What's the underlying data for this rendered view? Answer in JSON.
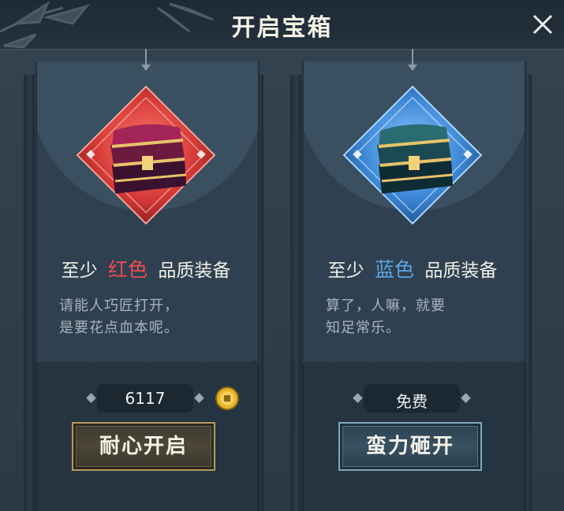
{
  "window": {
    "title": "开启宝箱",
    "close_icon": "close-icon"
  },
  "colors": {
    "red": "#ec4d4d",
    "blue": "#5aa6e6",
    "gold_border": "#b89a5d",
    "blue_border": "#7fa9bd"
  },
  "cards": [
    {
      "quality_prefix": "至少",
      "quality_color": "红色",
      "quality_suffix": "品质装备",
      "flavor_line1": "请能人巧匠打开，",
      "flavor_line2": "是要花点血本呢。",
      "price": "6117",
      "currency_icon": "gold-coin-icon",
      "button_label": "耐心开启",
      "chest_icon": "red-treasure-chest-icon"
    },
    {
      "quality_prefix": "至少",
      "quality_color": "蓝色",
      "quality_suffix": "品质装备",
      "flavor_line1": "算了，人嘛，就要",
      "flavor_line2": "知足常乐。",
      "price": "免费",
      "button_label": "蛮力砸开",
      "chest_icon": "blue-treasure-chest-icon"
    }
  ]
}
